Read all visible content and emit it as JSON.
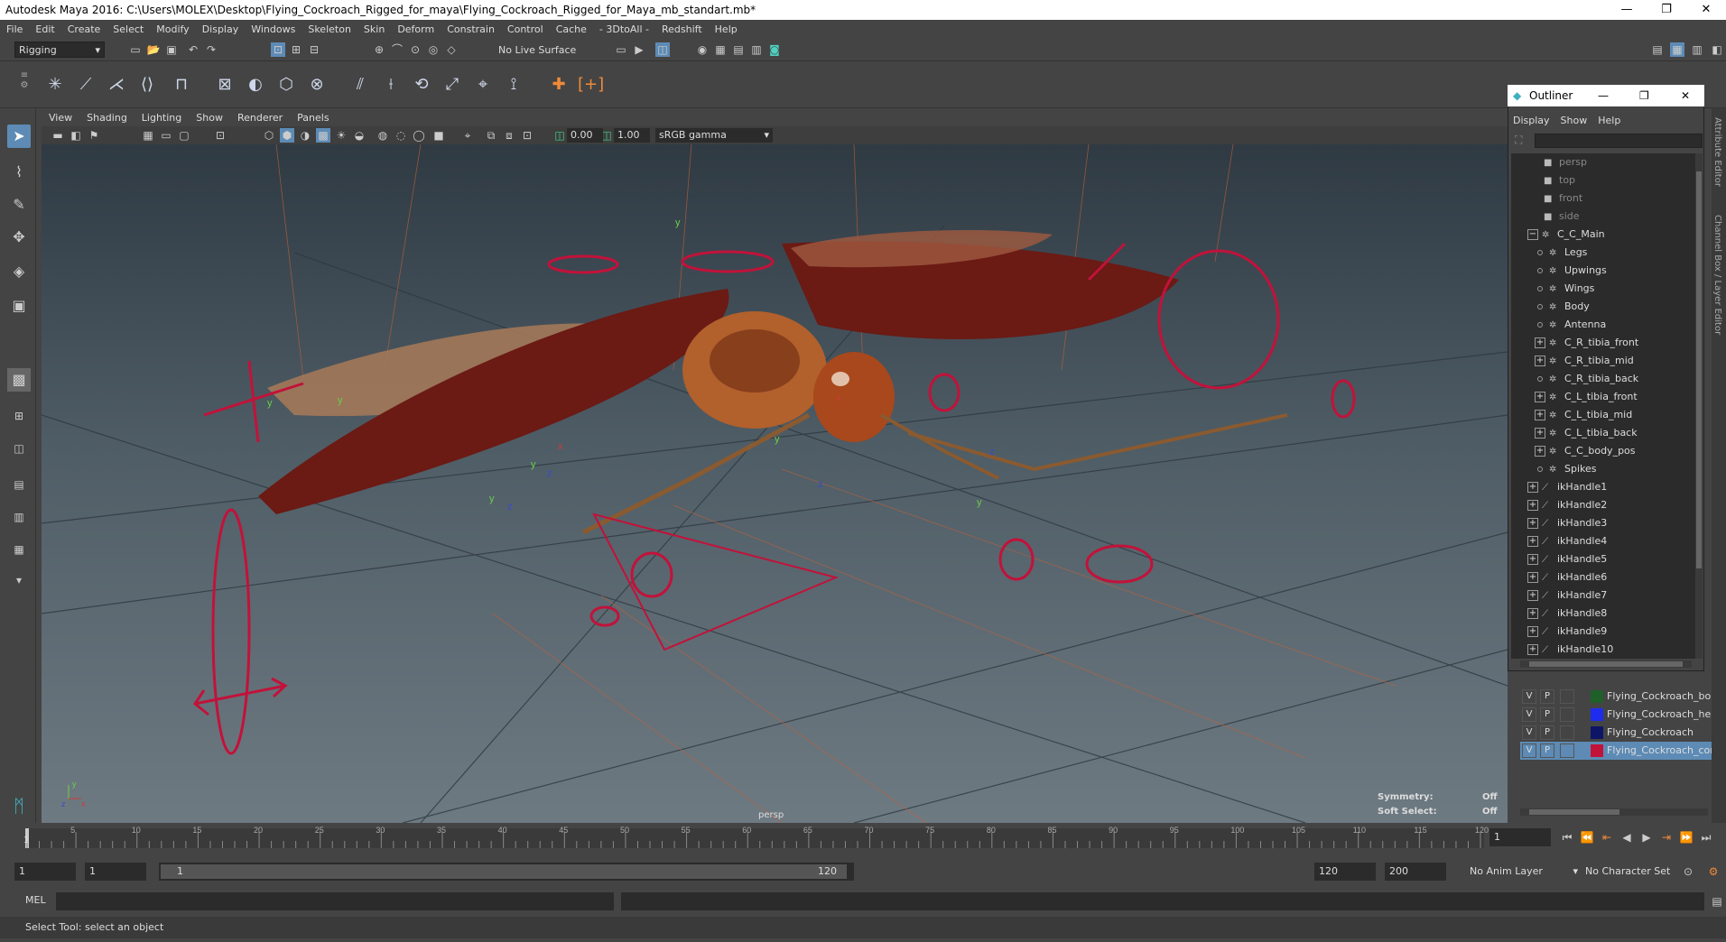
{
  "window": {
    "title": "Autodesk Maya 2016: C:\\Users\\MOLEX\\Desktop\\Flying_Cockroach_Rigged_for_maya\\Flying_Cockroach_Rigged_for_Maya_mb_standart.mb*",
    "minimize": "—",
    "maximize": "❐",
    "close": "✕"
  },
  "menubar": [
    "File",
    "Edit",
    "Create",
    "Select",
    "Modify",
    "Display",
    "Windows",
    "Skeleton",
    "Skin",
    "Deform",
    "Constrain",
    "Control",
    "Cache",
    "- 3DtoAll -",
    "Redshift",
    "Help"
  ],
  "status_line": {
    "mode": "Rigging",
    "live_surface": "No Live Surface"
  },
  "viewport": {
    "menu": [
      "View",
      "Shading",
      "Lighting",
      "Show",
      "Renderer",
      "Panels"
    ],
    "near_value": "0.00",
    "far_value": "1.00",
    "color_space": "sRGB gamma",
    "camera_label": "persp",
    "hud": {
      "symmetry_label": "Symmetry:",
      "symmetry_value": "Off",
      "soft_select_label": "Soft Select:",
      "soft_select_value": "Off"
    },
    "axis_labels": {
      "x": "x",
      "y": "y",
      "z": "z"
    }
  },
  "outliner": {
    "title": "Outliner",
    "menu": [
      "Display",
      "Show",
      "Help"
    ],
    "items": [
      {
        "label": "persp",
        "type": "camera",
        "depth": 1,
        "exp": "none",
        "dim": true
      },
      {
        "label": "top",
        "type": "camera",
        "depth": 1,
        "exp": "none",
        "dim": true
      },
      {
        "label": "front",
        "type": "camera",
        "depth": 1,
        "exp": "none",
        "dim": true
      },
      {
        "label": "side",
        "type": "camera",
        "depth": 1,
        "exp": "none",
        "dim": true
      },
      {
        "label": "C_C_Main",
        "type": "group",
        "depth": 0,
        "exp": "minus",
        "dim": false
      },
      {
        "label": "Legs",
        "type": "group",
        "depth": 2,
        "exp": "dot",
        "dim": false
      },
      {
        "label": "Upwings",
        "type": "group",
        "depth": 2,
        "exp": "dot",
        "dim": false
      },
      {
        "label": "Wings",
        "type": "group",
        "depth": 2,
        "exp": "dot",
        "dim": false
      },
      {
        "label": "Body",
        "type": "group",
        "depth": 2,
        "exp": "dot",
        "dim": false
      },
      {
        "label": "Antenna",
        "type": "group",
        "depth": 2,
        "exp": "dot",
        "dim": false
      },
      {
        "label": "C_R_tibia_front",
        "type": "group",
        "depth": 2,
        "exp": "plus",
        "dim": false
      },
      {
        "label": "C_R_tibia_mid",
        "type": "group",
        "depth": 2,
        "exp": "plus",
        "dim": false
      },
      {
        "label": "C_R_tibia_back",
        "type": "group",
        "depth": 2,
        "exp": "dot",
        "dim": false
      },
      {
        "label": "C_L_tibia_front",
        "type": "group",
        "depth": 2,
        "exp": "plus",
        "dim": false
      },
      {
        "label": "C_L_tibia_mid",
        "type": "group",
        "depth": 2,
        "exp": "plus",
        "dim": false
      },
      {
        "label": "C_L_tibia_back",
        "type": "group",
        "depth": 2,
        "exp": "plus",
        "dim": false
      },
      {
        "label": "C_C_body_pos",
        "type": "group",
        "depth": 2,
        "exp": "plus",
        "dim": false
      },
      {
        "label": "Spikes",
        "type": "group",
        "depth": 2,
        "exp": "dot",
        "dim": false
      },
      {
        "label": "ikHandle1",
        "type": "ik",
        "depth": 0,
        "exp": "plus",
        "dim": false
      },
      {
        "label": "ikHandle2",
        "type": "ik",
        "depth": 0,
        "exp": "plus",
        "dim": false
      },
      {
        "label": "ikHandle3",
        "type": "ik",
        "depth": 0,
        "exp": "plus",
        "dim": false
      },
      {
        "label": "ikHandle4",
        "type": "ik",
        "depth": 0,
        "exp": "plus",
        "dim": false
      },
      {
        "label": "ikHandle5",
        "type": "ik",
        "depth": 0,
        "exp": "plus",
        "dim": false
      },
      {
        "label": "ikHandle6",
        "type": "ik",
        "depth": 0,
        "exp": "plus",
        "dim": false
      },
      {
        "label": "ikHandle7",
        "type": "ik",
        "depth": 0,
        "exp": "plus",
        "dim": false
      },
      {
        "label": "ikHandle8",
        "type": "ik",
        "depth": 0,
        "exp": "plus",
        "dim": false
      },
      {
        "label": "ikHandle9",
        "type": "ik",
        "depth": 0,
        "exp": "plus",
        "dim": false
      },
      {
        "label": "ikHandle10",
        "type": "ik",
        "depth": 0,
        "exp": "plus",
        "dim": false
      }
    ]
  },
  "layers": [
    {
      "v": "V",
      "p": "P",
      "color": "#1f5f2a",
      "name": "Flying_Cockroach_bon",
      "selected": false
    },
    {
      "v": "V",
      "p": "P",
      "color": "#1e2cf0",
      "name": "Flying_Cockroach_help",
      "selected": false
    },
    {
      "v": "V",
      "p": "P",
      "color": "#0f1566",
      "name": "Flying_Cockroach",
      "selected": false
    },
    {
      "v": "V",
      "p": "P",
      "color": "#c2123a",
      "name": "Flying_Cockroach_con",
      "selected": true
    }
  ],
  "right_strip": {
    "attribute_editor": "Attribute Editor",
    "channel_box": "Channel Box / Layer Editor"
  },
  "timeline": {
    "ticks": [
      "5",
      "10",
      "15",
      "20",
      "25",
      "30",
      "35",
      "40",
      "45",
      "50",
      "55",
      "60",
      "65",
      "70",
      "75",
      "80",
      "85",
      "90",
      "95",
      "100",
      "105",
      "110",
      "115",
      "120"
    ],
    "start_marker": "1",
    "current_frame": "1"
  },
  "range": {
    "start": "1",
    "playback_start": "1",
    "slider_start": "1",
    "slider_end": "120",
    "playback_end": "120",
    "end": "200",
    "anim_layer": "No Anim Layer",
    "character_set": "No Character Set"
  },
  "command_line": {
    "lang": "MEL"
  },
  "help_line": "Select Tool: select an object",
  "colors": {
    "control_red": "#c2123a",
    "accent_blue": "#5d8bb5",
    "wing": "#6b1a14"
  }
}
